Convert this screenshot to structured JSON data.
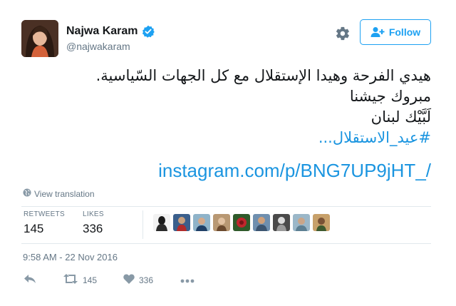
{
  "user": {
    "name": "Najwa Karam",
    "handle": "@najwakaram"
  },
  "follow_label": "Follow",
  "tweet": {
    "lines": [
      "هيدي الفرحة وهيدا الإستقلال مع كل الجهات السّياسية.",
      "مبروك جيشنا",
      "لَبَّيْك لبنان",
      "#عيد_الاستقلال..."
    ],
    "link": "instagram.com/p/BNG7UP9jHT_/"
  },
  "view_translation": "View translation",
  "stats": {
    "retweets_label": "RETWEETS",
    "retweets_value": "145",
    "likes_label": "LIKES",
    "likes_value": "336"
  },
  "timestamp": "9:58 AM - 22 Nov 2016",
  "actions": {
    "retweet_count": "145",
    "like_count": "336"
  },
  "colors": {
    "accent": "#1da1f2",
    "link": "#1b95e0",
    "muted": "#657786"
  },
  "icons": {
    "gear": "gear-icon",
    "follow": "add-user-icon",
    "globe": "globe-icon",
    "reply": "reply-icon",
    "retweet": "retweet-icon",
    "like": "heart-icon",
    "more": "more-icon"
  }
}
